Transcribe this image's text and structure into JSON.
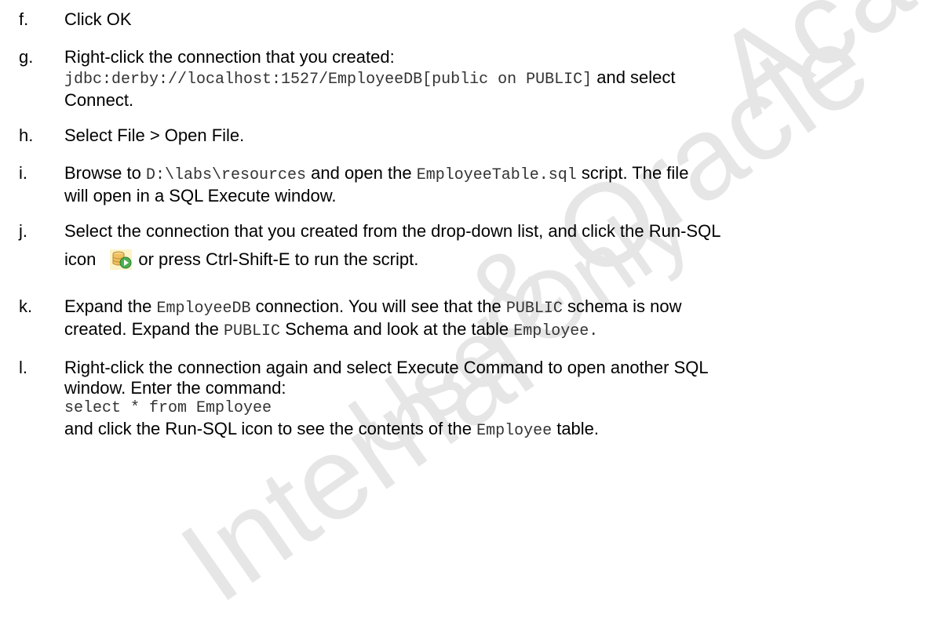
{
  "watermark": {
    "line1": "Acade",
    "line2": "& Oracle",
    "line3": "Internal",
    "line4": "Use Only"
  },
  "steps": [
    {
      "letter": "f.",
      "text": "Click OK"
    },
    {
      "letter": "g.",
      "text_before": "Right-click the connection that you created:",
      "code": "jdbc:derby://localhost:1527/EmployeeDB[public on PUBLIC]",
      "text_after_code": "and select",
      "text_line3": "Connect."
    },
    {
      "letter": "h.",
      "text": "Select File > Open File."
    },
    {
      "letter": "i.",
      "text_a": "Browse to",
      "code_a": "D:\\labs\\resources",
      "text_b": "and open the",
      "code_b": "EmployeeTable.sql",
      "text_c": "script. The file",
      "text_line2": "will open in a SQL Execute window."
    },
    {
      "letter": "j.",
      "text_line1": "Select the connection that you created from the drop-down list, and click the Run-SQL",
      "text_icon": "icon",
      "icon_name": "run-sql-icon",
      "text_after_icon": "or press Ctrl-Shift-E to run the script."
    },
    {
      "letter": "k.",
      "text_a": "Expand the",
      "code_a": "EmployeeDB",
      "text_b": "connection. You will see that the",
      "code_b": "PUBLIC",
      "text_c": "schema is now",
      "text_d": "created. Expand the",
      "code_c": "PUBLIC",
      "text_e": "Schema and look at the table",
      "code_d": "Employee."
    },
    {
      "letter": "l.",
      "text_line1": "Right-click the connection again and select Execute Command to open another SQL",
      "text_line2": "window. Enter the command:",
      "code_line": "select * from Employee",
      "text_a": "and click the Run-SQL icon to see the contents of the",
      "code_a": "Employee",
      "text_b": "table."
    }
  ],
  "colors": {
    "text": "#000000",
    "code": "#333333",
    "watermark": "#e6e6e6"
  }
}
